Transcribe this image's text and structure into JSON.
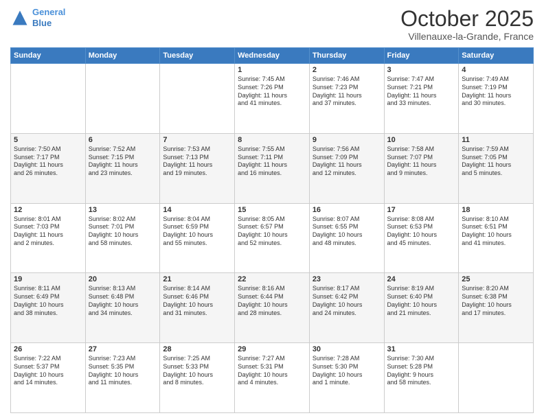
{
  "logo": {
    "line1": "General",
    "line2": "Blue"
  },
  "header": {
    "month": "October 2025",
    "location": "Villenauxe-la-Grande, France"
  },
  "days_of_week": [
    "Sunday",
    "Monday",
    "Tuesday",
    "Wednesday",
    "Thursday",
    "Friday",
    "Saturday"
  ],
  "weeks": [
    [
      {
        "day": "",
        "info": ""
      },
      {
        "day": "",
        "info": ""
      },
      {
        "day": "",
        "info": ""
      },
      {
        "day": "1",
        "info": "Sunrise: 7:45 AM\nSunset: 7:26 PM\nDaylight: 11 hours\nand 41 minutes."
      },
      {
        "day": "2",
        "info": "Sunrise: 7:46 AM\nSunset: 7:23 PM\nDaylight: 11 hours\nand 37 minutes."
      },
      {
        "day": "3",
        "info": "Sunrise: 7:47 AM\nSunset: 7:21 PM\nDaylight: 11 hours\nand 33 minutes."
      },
      {
        "day": "4",
        "info": "Sunrise: 7:49 AM\nSunset: 7:19 PM\nDaylight: 11 hours\nand 30 minutes."
      }
    ],
    [
      {
        "day": "5",
        "info": "Sunrise: 7:50 AM\nSunset: 7:17 PM\nDaylight: 11 hours\nand 26 minutes."
      },
      {
        "day": "6",
        "info": "Sunrise: 7:52 AM\nSunset: 7:15 PM\nDaylight: 11 hours\nand 23 minutes."
      },
      {
        "day": "7",
        "info": "Sunrise: 7:53 AM\nSunset: 7:13 PM\nDaylight: 11 hours\nand 19 minutes."
      },
      {
        "day": "8",
        "info": "Sunrise: 7:55 AM\nSunset: 7:11 PM\nDaylight: 11 hours\nand 16 minutes."
      },
      {
        "day": "9",
        "info": "Sunrise: 7:56 AM\nSunset: 7:09 PM\nDaylight: 11 hours\nand 12 minutes."
      },
      {
        "day": "10",
        "info": "Sunrise: 7:58 AM\nSunset: 7:07 PM\nDaylight: 11 hours\nand 9 minutes."
      },
      {
        "day": "11",
        "info": "Sunrise: 7:59 AM\nSunset: 7:05 PM\nDaylight: 11 hours\nand 5 minutes."
      }
    ],
    [
      {
        "day": "12",
        "info": "Sunrise: 8:01 AM\nSunset: 7:03 PM\nDaylight: 11 hours\nand 2 minutes."
      },
      {
        "day": "13",
        "info": "Sunrise: 8:02 AM\nSunset: 7:01 PM\nDaylight: 10 hours\nand 58 minutes."
      },
      {
        "day": "14",
        "info": "Sunrise: 8:04 AM\nSunset: 6:59 PM\nDaylight: 10 hours\nand 55 minutes."
      },
      {
        "day": "15",
        "info": "Sunrise: 8:05 AM\nSunset: 6:57 PM\nDaylight: 10 hours\nand 52 minutes."
      },
      {
        "day": "16",
        "info": "Sunrise: 8:07 AM\nSunset: 6:55 PM\nDaylight: 10 hours\nand 48 minutes."
      },
      {
        "day": "17",
        "info": "Sunrise: 8:08 AM\nSunset: 6:53 PM\nDaylight: 10 hours\nand 45 minutes."
      },
      {
        "day": "18",
        "info": "Sunrise: 8:10 AM\nSunset: 6:51 PM\nDaylight: 10 hours\nand 41 minutes."
      }
    ],
    [
      {
        "day": "19",
        "info": "Sunrise: 8:11 AM\nSunset: 6:49 PM\nDaylight: 10 hours\nand 38 minutes."
      },
      {
        "day": "20",
        "info": "Sunrise: 8:13 AM\nSunset: 6:48 PM\nDaylight: 10 hours\nand 34 minutes."
      },
      {
        "day": "21",
        "info": "Sunrise: 8:14 AM\nSunset: 6:46 PM\nDaylight: 10 hours\nand 31 minutes."
      },
      {
        "day": "22",
        "info": "Sunrise: 8:16 AM\nSunset: 6:44 PM\nDaylight: 10 hours\nand 28 minutes."
      },
      {
        "day": "23",
        "info": "Sunrise: 8:17 AM\nSunset: 6:42 PM\nDaylight: 10 hours\nand 24 minutes."
      },
      {
        "day": "24",
        "info": "Sunrise: 8:19 AM\nSunset: 6:40 PM\nDaylight: 10 hours\nand 21 minutes."
      },
      {
        "day": "25",
        "info": "Sunrise: 8:20 AM\nSunset: 6:38 PM\nDaylight: 10 hours\nand 17 minutes."
      }
    ],
    [
      {
        "day": "26",
        "info": "Sunrise: 7:22 AM\nSunset: 5:37 PM\nDaylight: 10 hours\nand 14 minutes."
      },
      {
        "day": "27",
        "info": "Sunrise: 7:23 AM\nSunset: 5:35 PM\nDaylight: 10 hours\nand 11 minutes."
      },
      {
        "day": "28",
        "info": "Sunrise: 7:25 AM\nSunset: 5:33 PM\nDaylight: 10 hours\nand 8 minutes."
      },
      {
        "day": "29",
        "info": "Sunrise: 7:27 AM\nSunset: 5:31 PM\nDaylight: 10 hours\nand 4 minutes."
      },
      {
        "day": "30",
        "info": "Sunrise: 7:28 AM\nSunset: 5:30 PM\nDaylight: 10 hours\nand 1 minute."
      },
      {
        "day": "31",
        "info": "Sunrise: 7:30 AM\nSunset: 5:28 PM\nDaylight: 9 hours\nand 58 minutes."
      },
      {
        "day": "",
        "info": ""
      }
    ]
  ]
}
